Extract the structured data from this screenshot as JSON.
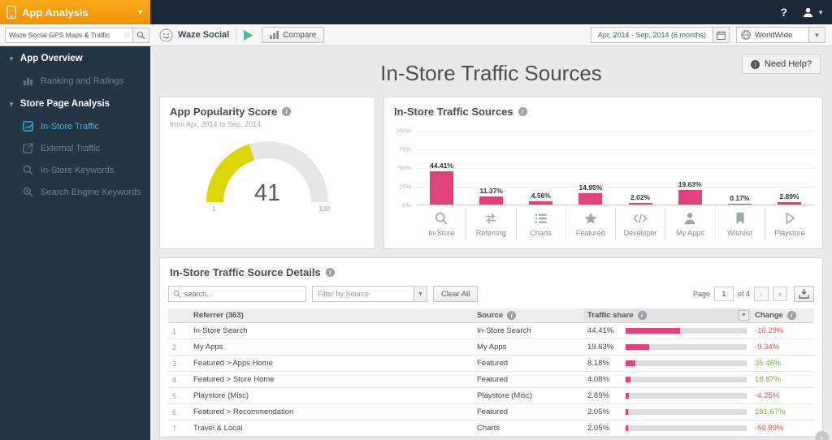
{
  "colors": {
    "accent_pink": "#e2407e",
    "active_blue": "#3db7e4",
    "positive_green": "#7cb82f",
    "negative_red": "#e8524a",
    "gauge_yellow": "#ddd605",
    "brand_orange": "#fbaa1c",
    "navy": "#1b2838",
    "sidebar": "#243546"
  },
  "topbar": {
    "brand": "App Analysis",
    "help": "?"
  },
  "toolbar": {
    "search_value": "Waze Social GPS Maps & Traffic",
    "app_name": "Waze Social",
    "compare": "Compare",
    "date_range": "Apr, 2014 - Sep, 2014 (6 months)",
    "region": "WorldWide"
  },
  "sidebar": {
    "sections": [
      {
        "label": "App Overview",
        "items": [
          {
            "label": "Ranking and Ratings"
          }
        ]
      },
      {
        "label": "Store Page Analysis",
        "items": [
          {
            "label": "In-Store Traffic"
          },
          {
            "label": "External Traffic"
          },
          {
            "label": "In-Store Keywords"
          },
          {
            "label": "Search Engine Keywords"
          }
        ]
      }
    ]
  },
  "page": {
    "title": "In-Store Traffic Sources",
    "need_help": "Need Help?"
  },
  "popularity": {
    "title": "App Popularity Score",
    "subtitle": "from Apr, 2014 to Sep, 2014",
    "score": 41,
    "min": 1,
    "max": 100
  },
  "chart_data": {
    "type": "bar",
    "title": "In-Store Traffic Sources",
    "categories": [
      "In-Store",
      "Referring",
      "Charts",
      "Featured",
      "Developer",
      "My Apps",
      "Wishlist",
      "Playstore"
    ],
    "values": [
      44.41,
      11.37,
      4.56,
      14.95,
      2.02,
      19.63,
      0.17,
      2.89
    ],
    "labels": [
      "44.41%",
      "11.37%",
      "4.56%",
      "14.95%",
      "2.02%",
      "19.63%",
      "0.17%",
      "2.89%"
    ],
    "ylim": [
      0,
      100
    ],
    "yticks": [
      "100%",
      "75%",
      "50%",
      "25%",
      "0%"
    ],
    "grid": true,
    "bar_color": "#e2407e"
  },
  "details": {
    "title": "In-Store Traffic Source Details",
    "search_placeholder": "search...",
    "filter_label": "Filter by Source",
    "clear_label": "Clear All",
    "page_label": "Page",
    "page_value": "1",
    "page_total": "of 4",
    "prev_label": "‹",
    "next_label": "›",
    "columns": {
      "referrer": "Referrer (363)",
      "source": "Source",
      "share": "Traffic share",
      "change": "Change"
    },
    "rows": [
      {
        "num": "1",
        "referrer": "In-Store Search",
        "source": "In-Store Search",
        "share": "44.41%",
        "share_value": 44.41,
        "change": "-16.29%"
      },
      {
        "num": "2",
        "referrer": "My Apps",
        "source": "My Apps",
        "share": "19.63%",
        "share_value": 19.63,
        "change": "-9.34%"
      },
      {
        "num": "3",
        "referrer": "Featured > Apps Home",
        "source": "Featured",
        "share": "8.18%",
        "share_value": 8.18,
        "change": "35.46%"
      },
      {
        "num": "4",
        "referrer": "Featured > Store Home",
        "source": "Featured",
        "share": "4.08%",
        "share_value": 4.08,
        "change": "18.87%"
      },
      {
        "num": "5",
        "referrer": "Playstore (Misc)",
        "source": "Playstore (Misc)",
        "share": "2.89%",
        "share_value": 2.89,
        "change": "-4.25%"
      },
      {
        "num": "6",
        "referrer": "Featured > Recommendation",
        "source": "Featured",
        "share": "2.05%",
        "share_value": 2.05,
        "change": "181.67%"
      },
      {
        "num": "7",
        "referrer": "Travel & Local",
        "source": "Charts",
        "share": "2.05%",
        "share_value": 2.05,
        "change": "-59.89%"
      }
    ]
  }
}
